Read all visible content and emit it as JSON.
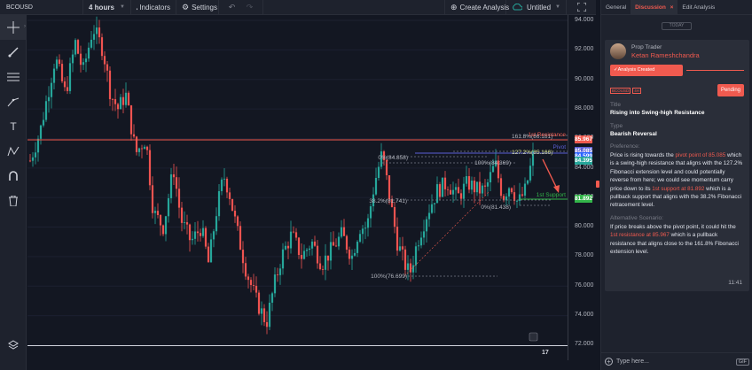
{
  "toolbar": {
    "symbol": "BCOUSD",
    "interval": "4 hours",
    "indicators": "Indicators",
    "settings": "Settings",
    "create_analysis": "Create Analysis",
    "layout_name": "Untitled"
  },
  "left_tools": [
    "crosshair",
    "brush",
    "horizontal-lines",
    "trend-line",
    "text",
    "node-pattern",
    "magnet",
    "trash"
  ],
  "chart": {
    "price_ticks": [
      "94.000",
      "92.000",
      "90.000",
      "88.000",
      "86.000",
      "84.000",
      "82.000",
      "80.000",
      "78.000",
      "76.000",
      "74.000",
      "72.000"
    ],
    "time_label": "17",
    "price_tags": [
      {
        "value": "85.967",
        "color": "#f05a4f"
      },
      {
        "value": "85.085",
        "color": "#5b5fd6"
      },
      {
        "value": "84.599",
        "color": "#2962ff"
      },
      {
        "value": "84.395",
        "color": "#26a69a"
      },
      {
        "value": "81.892",
        "color": "#33b54a"
      }
    ],
    "levels": {
      "resistance": "1st Resistance",
      "pivot": "Pivot",
      "support": "1st Support"
    },
    "fib_labels": {
      "f1618": "161.8%(86.181)",
      "f1272": "127.2%(85.166)",
      "f0_top": "0%(84.858)",
      "f100_mid": "100%(84.369)",
      "f382": "38.2%(81.741)",
      "f0_mid": "0%(81.438)",
      "f100_low": "100%(76.699)"
    }
  },
  "panel": {
    "tabs": [
      "General",
      "Discussion",
      "Edit Analysis"
    ],
    "active_tab": "Discussion",
    "today": "TODAY",
    "role": "Prop Trader",
    "author": "Ketan Rameshchandra",
    "status_pill": "Analysis Created",
    "tags": [
      "BCOUSD",
      "4H"
    ],
    "pending": "Pending",
    "title_label": "Title",
    "title_value": "Rising into Swing-high Resistance",
    "type_label": "Type",
    "type_value": "Bearish Reversal",
    "pref_label": "Preference:",
    "pref_1": "Price is rising towards the ",
    "pref_hl1": "pivot point of 85.085",
    "pref_2": " which is a swing-high resistance that aligns with the 127.2% Fibonacci extension level and could potentially reverse from here; we could see momentum carry price down to its ",
    "pref_hl2": "1st support at 81.892",
    "pref_3": " which is a pullback support that aligns with the 38.2% Fibonacci retracement level.",
    "alt_label": "Alternative Scenario:",
    "alt_1": "If price breaks above the pivot point, it could hit the ",
    "alt_hl": "1st resistance at 85.967",
    "alt_2": " which is a pullback resistance that aligns close to the 161.8% Fibonacci extension level.",
    "time": "11:41",
    "composer_placeholder": "Type here...",
    "gif": "GIF"
  },
  "colors": {
    "background": "#131722",
    "accent": "#f05a4f",
    "up": "#26a69a",
    "down": "#ef5350"
  }
}
